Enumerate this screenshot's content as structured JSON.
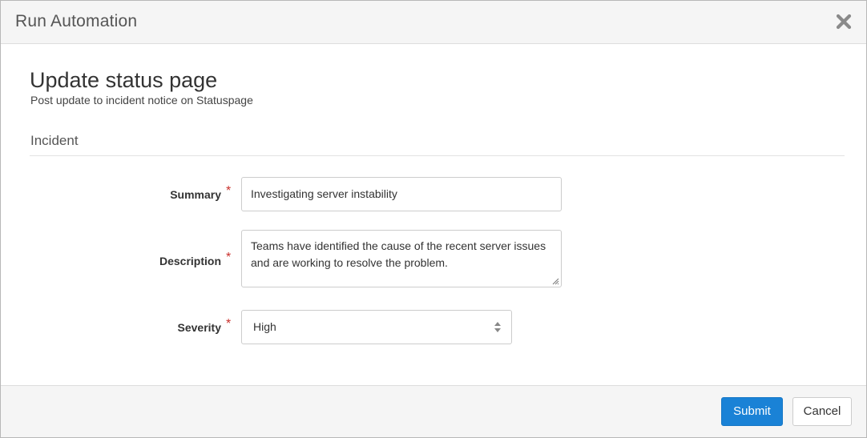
{
  "dialog": {
    "title": "Run Automation"
  },
  "automation": {
    "name": "Update status page",
    "description": "Post update to incident notice on Statuspage"
  },
  "section": {
    "title": "Incident"
  },
  "fields": {
    "summary": {
      "label": "Summary",
      "required_mark": "*",
      "value": "Investigating server instability"
    },
    "description": {
      "label": "Description",
      "required_mark": "*",
      "value": "Teams have identified the cause of the recent server issues and are working to resolve the problem."
    },
    "severity": {
      "label": "Severity",
      "required_mark": "*",
      "selected": "High"
    }
  },
  "footer": {
    "submit_label": "Submit",
    "cancel_label": "Cancel"
  },
  "icons": {
    "close": "close-icon",
    "select_arrows": "updown-arrows-icon",
    "resize": "resize-grip-icon"
  },
  "colors": {
    "primary": "#1a82d6",
    "required": "#c9302c",
    "header_bg": "#f5f5f5"
  }
}
